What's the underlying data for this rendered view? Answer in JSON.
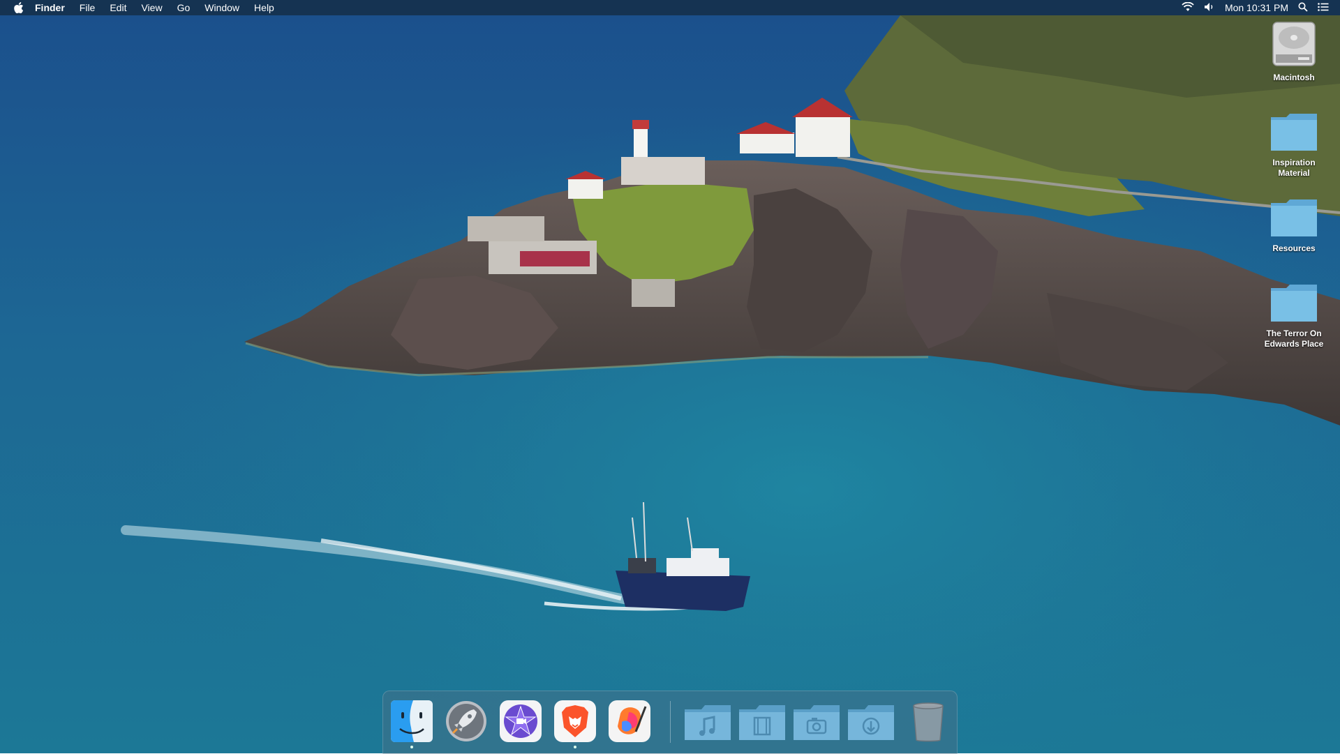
{
  "menubar": {
    "apple_icon": "apple-icon",
    "app_name": "Finder",
    "menus": [
      "File",
      "Edit",
      "View",
      "Go",
      "Window",
      "Help"
    ],
    "status_icons": [
      "wifi-icon",
      "volume-icon",
      "spotlight-icon",
      "notification-center-icon"
    ],
    "clock": "Mon 10:31 PM"
  },
  "desktop": {
    "icons": [
      {
        "label": "Macintosh",
        "icon": "hard-drive-icon"
      },
      {
        "label": "Inspiration\nMaterial",
        "icon": "folder-icon"
      },
      {
        "label": "Resources",
        "icon": "folder-icon"
      },
      {
        "label": "The Terror On\nEdwards Place",
        "icon": "folder-icon"
      }
    ]
  },
  "dock": {
    "apps": [
      {
        "name": "Finder",
        "icon": "finder-icon",
        "running": true
      },
      {
        "name": "Launchpad",
        "icon": "launchpad-rocket-icon",
        "running": false
      },
      {
        "name": "iMovie",
        "icon": "imovie-star-icon",
        "running": false
      },
      {
        "name": "Brave Browser",
        "icon": "brave-lion-icon",
        "running": true
      },
      {
        "name": "Pixelmator",
        "icon": "pixelmator-icon",
        "running": false
      }
    ],
    "stacks": [
      {
        "name": "Music",
        "icon": "music-folder-icon"
      },
      {
        "name": "Movies",
        "icon": "movies-folder-icon"
      },
      {
        "name": "Pictures",
        "icon": "pictures-folder-icon"
      },
      {
        "name": "Downloads",
        "icon": "downloads-folder-icon"
      }
    ],
    "trash_icon": "trash-icon"
  },
  "colors": {
    "sea_deep": "#1d4f86",
    "sea_light": "#1e7a9a",
    "folder": "#6fb6dd",
    "menubar": "#14283c"
  }
}
